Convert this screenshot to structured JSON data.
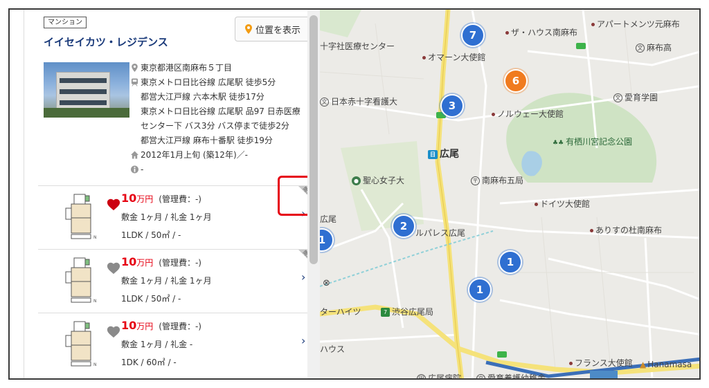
{
  "property": {
    "type_tag": "マンション",
    "name": "イイセイカツ・レジデンス",
    "location_button": "位置を表示",
    "address": "東京都港区南麻布５丁目",
    "access": [
      "東京メトロ日比谷線 広尾駅 徒歩5分",
      "都営大江戸線 六本木駅 徒歩17分",
      "東京メトロ日比谷線 広尾駅 品97 日赤医療",
      "センター下 バス3分 バス停まで徒歩2分",
      "都営大江戸線 麻布十番駅 徒歩19分"
    ],
    "built": "2012年1月上旬 (築12年)／-",
    "info": "-"
  },
  "units": [
    {
      "price": "10",
      "price_unit": "万円",
      "management": "(管理費：-)",
      "deposit": "敷金 1ヶ月 / 礼金 1ヶ月",
      "size": "1LDK / 50㎡ / -",
      "favorited": true,
      "viewed_label": "閲覧済"
    },
    {
      "price": "10",
      "price_unit": "万円",
      "management": "(管理費：-)",
      "deposit": "敷金 1ヶ月 / 礼金 1ヶ月",
      "size": "1LDK / 50㎡ / -",
      "favorited": false,
      "viewed_label": "閲覧済"
    },
    {
      "price": "10",
      "price_unit": "万円",
      "management": "(管理費：-)",
      "deposit": "敷金 1ヶ月 / 礼金 -",
      "size": "1DK / 60㎡ / -",
      "favorited": false
    }
  ],
  "map": {
    "labels": {
      "red_cross_center": "十字社医療センター",
      "the_house": "ザ・ハウス南麻布",
      "apartments": "アパートメンツ元麻布",
      "azabu_high": "麻布高",
      "oman_embassy": "オマーン大使館",
      "red_cross_nursing": "日本赤十字看護大",
      "aiiku": "愛育学園",
      "norway_embassy": "ノルウェー大使館",
      "arisugawa_park": "有栖川宮記念公園",
      "hiroo_station": "広尾",
      "seishin": "聖心女子大",
      "minami_azabu_post": "南麻布五局",
      "german_embassy": "ドイツ大使館",
      "hiroo_left": "広尾",
      "palace": "ルパレス広尾",
      "arisu_forest": "ありすの杜南麻布",
      "heights": "ターハイツ",
      "shibuya_post": "渋谷広尾局",
      "house_bottom": "ハウス",
      "french_embassy": "フランス大使館",
      "hanamasa": "Hanamasa",
      "hospital": "広尾病院",
      "kindergarten": "愛育養護幼稚舎"
    },
    "clusters": [
      {
        "count": "7",
        "color": "blue"
      },
      {
        "count": "6",
        "color": "orange"
      },
      {
        "count": "3",
        "color": "blue"
      },
      {
        "count": "2",
        "color": "blue"
      },
      {
        "count": "1",
        "color": "blue"
      },
      {
        "count": "1",
        "color": "blue"
      },
      {
        "count": "1",
        "color": "blue"
      }
    ],
    "colors": {
      "road_main": "#f5e27a",
      "park": "#cfe3c4",
      "water": "#a9cfe6",
      "cluster_blue": "#2f6fd1",
      "cluster_orange": "#f07b1f"
    }
  },
  "colors": {
    "price_red": "#e60012",
    "title_blue": "#1a3a7a",
    "highlight": "#e60012"
  }
}
